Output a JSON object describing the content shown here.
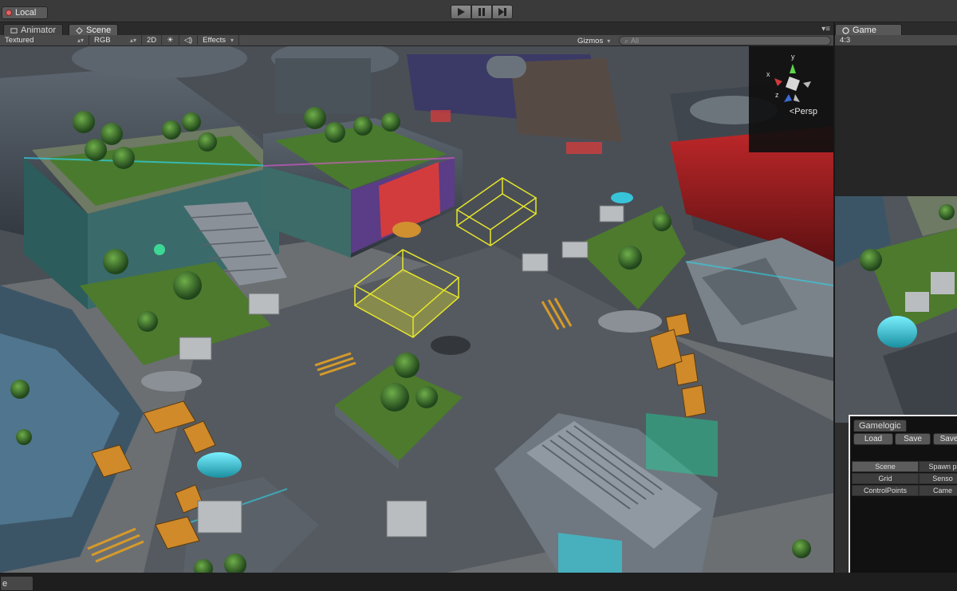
{
  "toolbar": {
    "local_label": "Local",
    "play_icon": "play-icon",
    "pause_icon": "pause-icon",
    "step_icon": "step-icon"
  },
  "tabs": [
    {
      "label": "Animator"
    },
    {
      "label": "Scene"
    }
  ],
  "scene_bar": {
    "shading": "Textured",
    "render_mode": "RGB",
    "mode_2d": "2D",
    "effects": "Effects",
    "gizmos": "Gizmos",
    "search_placeholder": "All"
  },
  "scene": {
    "projection": "Persp",
    "axis_y": "y",
    "axis_x": "x",
    "axis_z": "z"
  },
  "game": {
    "tab_label": "Game",
    "aspect": "4:3"
  },
  "gamelogic": {
    "title": "Gamelogic",
    "load": "Load",
    "save": "Save",
    "save2": "Save",
    "grid_cells": [
      [
        "Scene",
        "Spawn p"
      ],
      [
        "Grid",
        "Senso"
      ],
      [
        "ControlPoints",
        "Came"
      ]
    ]
  },
  "bottom": {
    "tab_label": "e"
  },
  "colors": {
    "editor_bg": "#3a3a3a",
    "selection_yellow": "#e6e62a",
    "accent_cyan": "#2fd3e6",
    "glow_red": "#e23a3a"
  }
}
